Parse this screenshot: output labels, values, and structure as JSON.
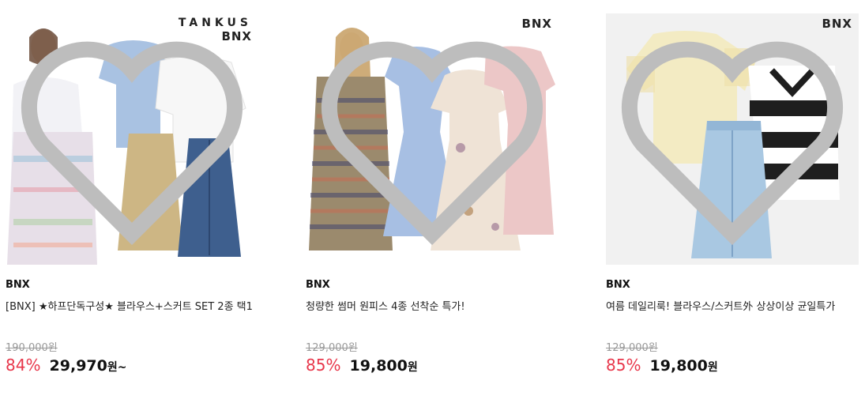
{
  "products": [
    {
      "logo_line1": "TANKUS",
      "logo_line2": "BNX",
      "brand": "BNX",
      "title": "[BNX] ★하프단독구성★ 블라우스+스커트 SET 2종 택1",
      "original_price": "190,000원",
      "discount": "84%",
      "price": "29,970",
      "price_suffix": "원~",
      "colors": {
        "blouse_blue": "#a9c2e2",
        "blouse_white": "#f7f7f7",
        "skirt_beige": "#cdb684",
        "skirt_denim": "#3e5f8e"
      }
    },
    {
      "logo_line1": "",
      "logo_line2": "BNX",
      "brand": "BNX",
      "title": "청량한 썸머 원피스 4종 선착순 특가!",
      "original_price": "129,000원",
      "discount": "85%",
      "price": "19,800",
      "price_suffix": "원",
      "colors": {
        "dress_blue": "#a7bfe3",
        "dress_floral": "#efe3d6",
        "dress_pink": "#ecc7c7",
        "dress_pattern": "#9b8a6d"
      }
    },
    {
      "logo_line1": "",
      "logo_line2": "BNX",
      "brand": "BNX",
      "title": "여름 데일리룩! 블라우스/스커트外 상상이상 균일특가",
      "original_price": "129,000원",
      "discount": "85%",
      "price": "19,800",
      "price_suffix": "원",
      "colors": {
        "top_yellow": "#f3ebc3",
        "skirt_lightdenim": "#a9c8e2",
        "knit_stripe": "#1e1e1e"
      }
    }
  ],
  "accent_color": "#e8364a",
  "wishlist_icon": "heart-outline-icon"
}
